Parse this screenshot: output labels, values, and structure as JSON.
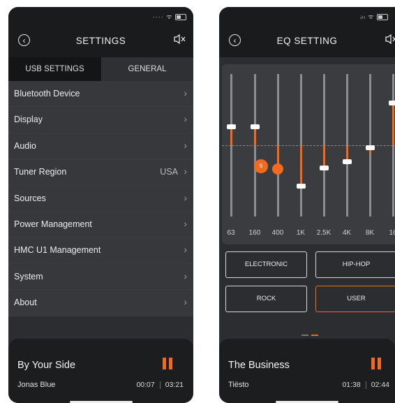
{
  "settings_screen": {
    "title": "SETTINGS",
    "tabs": [
      "USB SETTINGS",
      "GENERAL"
    ],
    "items": [
      {
        "label": "Bluetooth Device",
        "value": ""
      },
      {
        "label": "Display",
        "value": ""
      },
      {
        "label": "Audio",
        "value": ""
      },
      {
        "label": "Tuner Region",
        "value": "USA"
      },
      {
        "label": "Sources",
        "value": ""
      },
      {
        "label": "Power Management",
        "value": ""
      },
      {
        "label": "HMC U1 Management",
        "value": ""
      },
      {
        "label": "System",
        "value": ""
      },
      {
        "label": "About",
        "value": ""
      }
    ],
    "player": {
      "song": "By Your Side",
      "artist": "Jonas Blue",
      "elapsed": "00:07",
      "duration": "03:21"
    }
  },
  "eq_screen": {
    "title": "EQ SETTING",
    "bands": [
      "63",
      "160",
      "400",
      "1K",
      "2.5K",
      "4K",
      "8K",
      "16"
    ],
    "active_band_value": "6",
    "presets": [
      "ELECTRONIC",
      "HIP-HOP",
      "ROCK",
      "USER"
    ],
    "selected_preset": "USER",
    "player": {
      "song": "The Business",
      "artist": "Tiësto",
      "elapsed": "01:38",
      "duration": "02:44"
    }
  },
  "colors": {
    "accent": "#f26a1f",
    "background": "#2b2d30",
    "header": "#1a1b1d"
  },
  "icons": {
    "back": "back-circle-icon",
    "mute": "speaker-mute-icon",
    "pause": "pause-icon",
    "chevron": "chevron-right-icon"
  }
}
